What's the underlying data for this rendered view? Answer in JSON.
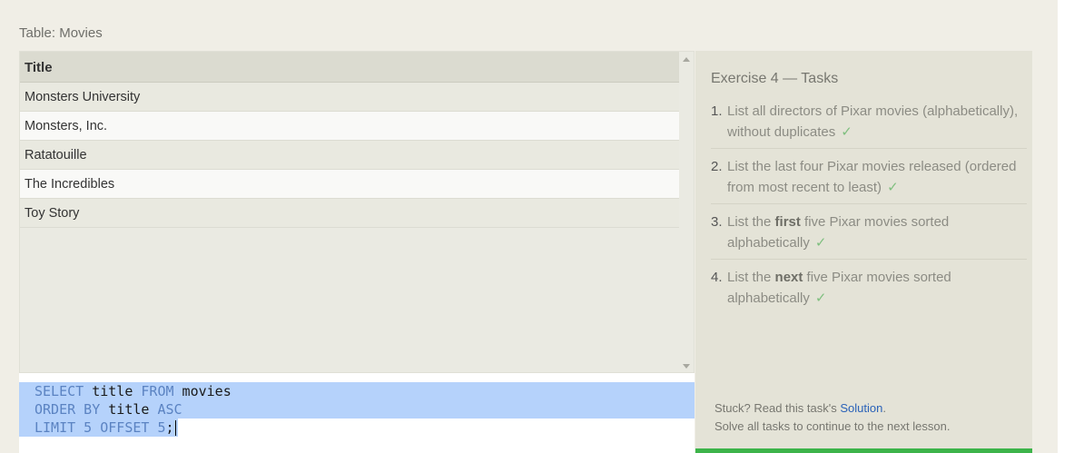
{
  "table_caption": "Table: Movies",
  "results": {
    "header": "Title",
    "rows": [
      "Monsters University",
      "Monsters, Inc.",
      "Ratatouille",
      "The Incredibles",
      "Toy Story"
    ]
  },
  "editor": {
    "line1": {
      "kw1": "SELECT",
      "id1": " title ",
      "kw2": "FROM",
      "id2": " movies"
    },
    "line2": {
      "kw1": "ORDER BY",
      "id1": " title ",
      "kw2": "ASC"
    },
    "line3": {
      "kw1": "LIMIT",
      "num1": " 5 ",
      "kw2": "OFFSET",
      "num2": " 5",
      "end": ";"
    }
  },
  "tasks": {
    "title": "Exercise 4 — Tasks",
    "items": [
      {
        "num": "1.",
        "text": "List all directors of Pixar movies (alphabetically), without duplicates",
        "check": "✓"
      },
      {
        "num": "2.",
        "text": "List the last four Pixar movies released (ordered from most recent to least)",
        "check": "✓"
      },
      {
        "num": "3.",
        "pre": "List the ",
        "bold": "first",
        "post": " five Pixar movies sorted alphabetically",
        "check": "✓"
      },
      {
        "num": "4.",
        "pre": "List the ",
        "bold": "next",
        "post": " five Pixar movies sorted alphabetically",
        "check": "✓"
      }
    ],
    "help_prefix": "Stuck? Read this task's ",
    "help_link": "Solution",
    "help_suffix": ".",
    "help_line2": "Solve all tasks to continue to the next lesson."
  },
  "colors": {
    "accent_green": "#3cb44a",
    "link_blue": "#2a62b8",
    "selection": "#b5d2fb"
  }
}
